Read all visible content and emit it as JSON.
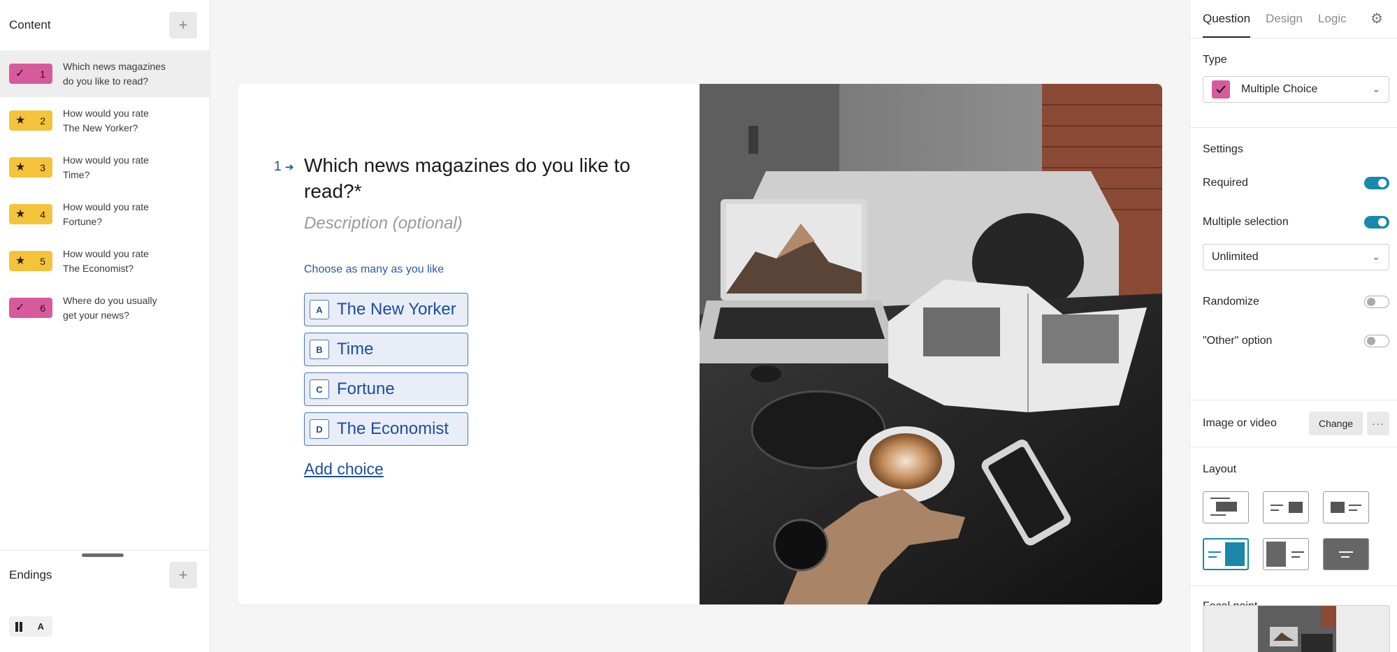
{
  "sidebar": {
    "title": "Content",
    "add_label": "+",
    "questions": [
      {
        "number": "1",
        "type": "check",
        "text": "Which news magazines\ndo you like to read?",
        "active": true
      },
      {
        "number": "2",
        "type": "star",
        "text": "How would you rate\nThe New Yorker?"
      },
      {
        "number": "3",
        "type": "star",
        "text": "How would you rate\nTime?"
      },
      {
        "number": "4",
        "type": "star",
        "text": "How would you rate\nFortune?"
      },
      {
        "number": "5",
        "type": "star",
        "text": "How would you rate\nThe Economist?"
      },
      {
        "number": "6",
        "type": "check",
        "text": "Where do you usually\nget your news?"
      }
    ],
    "endings": {
      "title": "Endings",
      "add_label": "+",
      "badge_letter": "A"
    }
  },
  "canvas": {
    "number": "1",
    "arrow": "➔",
    "title": "Which news magazines do you like to read?*",
    "description_placeholder": "Description (optional)",
    "hint": "Choose as many as you like",
    "choices": [
      {
        "key": "A",
        "label": "The New Yorker"
      },
      {
        "key": "B",
        "label": "Time"
      },
      {
        "key": "C",
        "label": "Fortune"
      },
      {
        "key": "D",
        "label": "The Economist"
      }
    ],
    "add_choice": "Add choice",
    "image_icon": "photo-laptop-coffee-magazine"
  },
  "panel": {
    "tabs": [
      "Question",
      "Design",
      "Logic"
    ],
    "active_tab": "Question",
    "type_label": "Type",
    "type_value": "Multiple Choice",
    "settings_label": "Settings",
    "required_label": "Required",
    "required": true,
    "multiple_label": "Multiple selection",
    "multiple": true,
    "limit_value": "Unlimited",
    "randomize_label": "Randomize",
    "randomize": false,
    "other_label": "\"Other\" option",
    "other": false,
    "media_label": "Image or video",
    "change_label": "Change",
    "more_label": "···",
    "layout_label": "Layout",
    "selected_layout": 4,
    "focal_label": "Focal point"
  },
  "colors": {
    "accent_blue": "#1d4e9a",
    "toggle_on": "#1a88a8",
    "badge_pink": "#d65a9c",
    "badge_yellow": "#f5c33b"
  }
}
